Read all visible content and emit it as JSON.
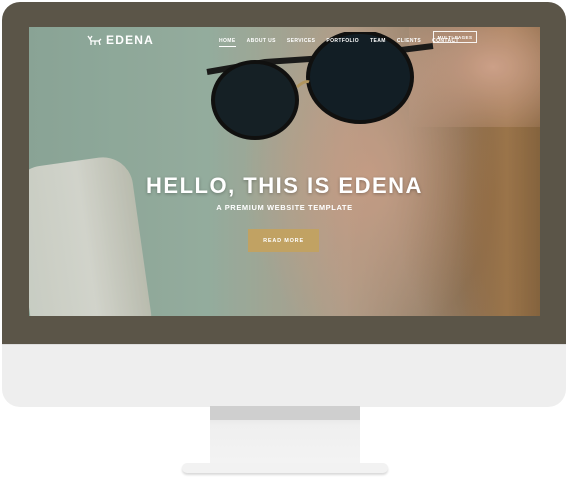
{
  "brand": {
    "name": "EDENA",
    "logo_icon": "deer-icon"
  },
  "nav": {
    "items": [
      {
        "label": "HOME",
        "active": true
      },
      {
        "label": "ABOUT US",
        "active": false
      },
      {
        "label": "SERVICES",
        "active": false
      },
      {
        "label": "PORTFOLIO",
        "active": false
      },
      {
        "label": "TEAM",
        "active": false
      },
      {
        "label": "CLIENTS",
        "active": false
      },
      {
        "label": "CONTACT",
        "active": false
      }
    ],
    "button_label": "MULTI-PAGES"
  },
  "hero": {
    "title": "HELLO, THIS IS EDENA",
    "subtitle": "A PREMIUM WEBSITE TEMPLATE",
    "button_label": "READ MORE"
  },
  "colors": {
    "bezel": "#5b5548",
    "accent": "#c1a263",
    "chin": "#eeeeee"
  }
}
